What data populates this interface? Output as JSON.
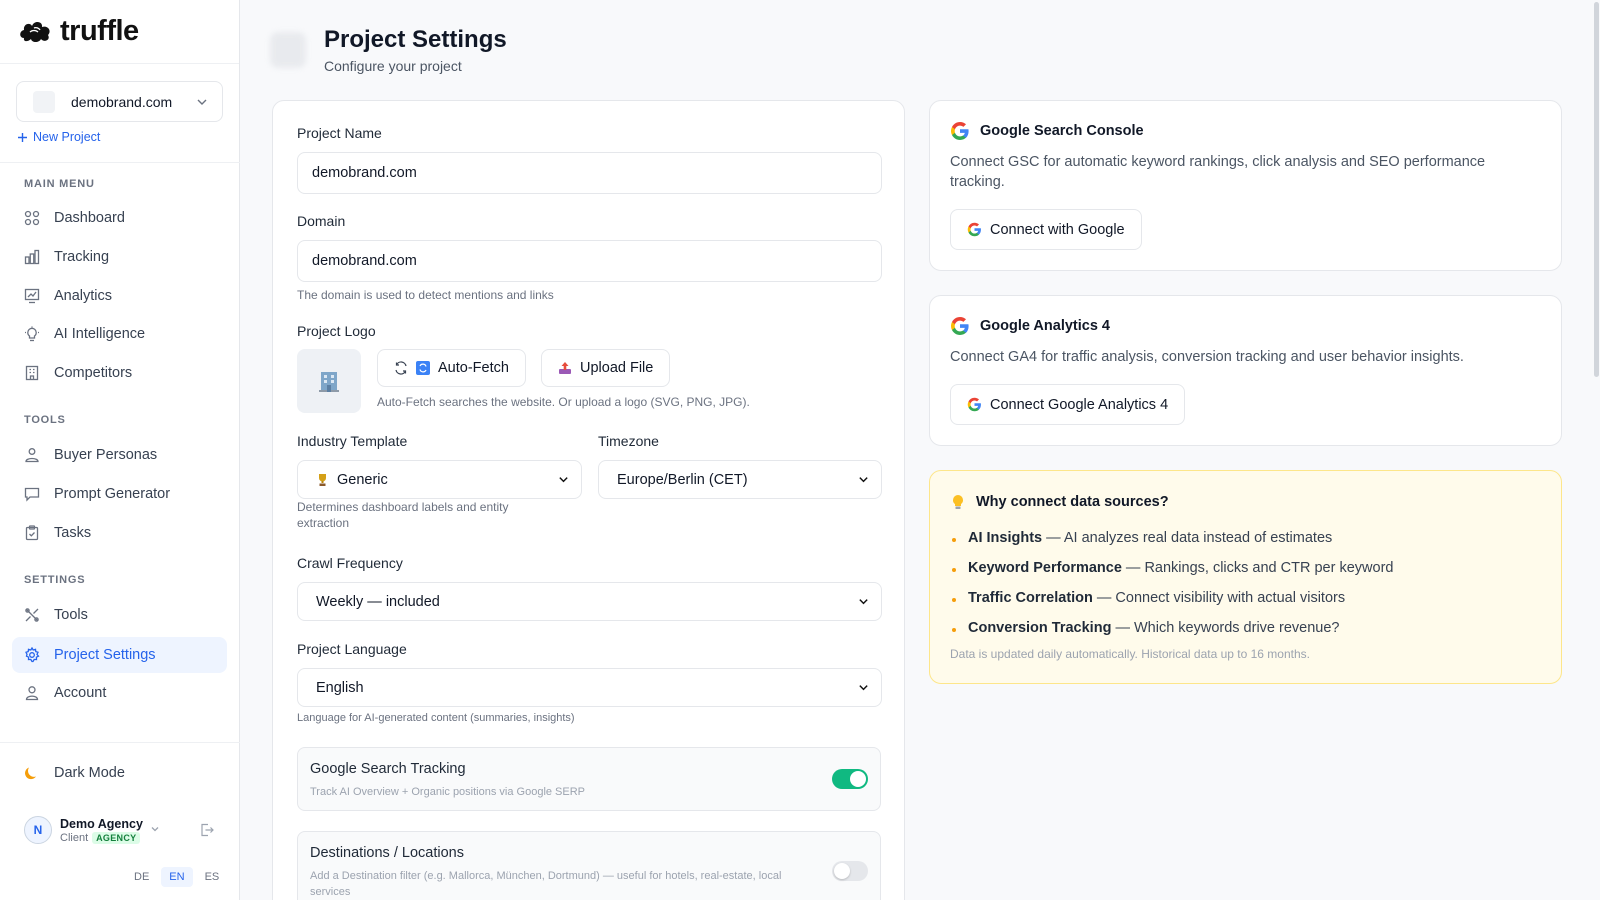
{
  "brand": {
    "name": "truffle"
  },
  "sidebar": {
    "project": "demobrand.com",
    "new_project": "New Project",
    "sections": {
      "main": "MAIN MENU",
      "tools": "TOOLS",
      "settings": "SETTINGS"
    },
    "main_items": [
      {
        "label": "Dashboard",
        "icon": "grid-icon"
      },
      {
        "label": "Tracking",
        "icon": "bar-chart-icon"
      },
      {
        "label": "Analytics",
        "icon": "line-chart-icon"
      },
      {
        "label": "AI Intelligence",
        "icon": "lightbulb-icon"
      },
      {
        "label": "Competitors",
        "icon": "building-icon"
      }
    ],
    "tools_items": [
      {
        "label": "Buyer Personas",
        "icon": "users-icon"
      },
      {
        "label": "Prompt Generator",
        "icon": "message-icon"
      },
      {
        "label": "Tasks",
        "icon": "clipboard-icon"
      }
    ],
    "settings_items": [
      {
        "label": "Tools",
        "icon": "wrench-icon"
      },
      {
        "label": "Project Settings",
        "icon": "gear-icon",
        "active": true
      },
      {
        "label": "Account",
        "icon": "user-icon"
      }
    ],
    "dark_mode": "Dark Mode",
    "user": {
      "initial": "N",
      "name": "Demo Agency",
      "role": "Client",
      "badge": "AGENCY"
    },
    "languages": [
      "DE",
      "EN",
      "ES"
    ],
    "active_language": "EN"
  },
  "header": {
    "title": "Project Settings",
    "subtitle": "Configure your project"
  },
  "form": {
    "project_name": {
      "label": "Project Name",
      "value": "demobrand.com"
    },
    "domain": {
      "label": "Domain",
      "value": "demobrand.com",
      "hint": "The domain is used to detect mentions and links"
    },
    "logo": {
      "label": "Project Logo",
      "auto_fetch": "Auto-Fetch",
      "upload": "Upload File",
      "hint": "Auto-Fetch searches the website. Or upload a logo (SVG, PNG, JPG)."
    },
    "industry": {
      "label": "Industry Template",
      "value": "Generic",
      "hint": "Determines dashboard labels and entity extraction"
    },
    "timezone": {
      "label": "Timezone",
      "value": "Europe/Berlin (CET)"
    },
    "crawl": {
      "label": "Crawl Frequency",
      "value": "Weekly — included"
    },
    "language": {
      "label": "Project Language",
      "value": "English",
      "hint": "Language for AI-generated content (summaries, insights)"
    },
    "google_tracking": {
      "title": "Google Search Tracking",
      "desc": "Track AI Overview + Organic positions via Google SERP",
      "enabled": true
    },
    "destinations": {
      "title": "Destinations / Locations",
      "desc": "Add a Destination filter (e.g. Mallorca, München, Dortmund) — useful for hotels, real-estate, local services",
      "enabled": false
    }
  },
  "integrations": {
    "gsc": {
      "title": "Google Search Console",
      "desc": "Connect GSC for automatic keyword rankings, click analysis and SEO performance tracking.",
      "button": "Connect with Google"
    },
    "ga4": {
      "title": "Google Analytics 4",
      "desc": "Connect GA4 for traffic analysis, conversion tracking and user behavior insights.",
      "button": "Connect Google Analytics 4"
    }
  },
  "why": {
    "title": "Why connect data sources?",
    "items": [
      {
        "bold": "AI Insights",
        "text": "— AI analyzes real data instead of estimates"
      },
      {
        "bold": "Keyword Performance",
        "text": "— Rankings, clicks and CTR per keyword"
      },
      {
        "bold": "Traffic Correlation",
        "text": "— Connect visibility with actual visitors"
      },
      {
        "bold": "Conversion Tracking",
        "text": "— Which keywords drive revenue?"
      }
    ],
    "footer": "Data is updated daily automatically. Historical data up to 16 months."
  },
  "colors": {
    "accent": "#2563eb",
    "toggle_on": "#10b981",
    "why_bg": "#fffbeb",
    "why_dot": "#f59e0b"
  }
}
